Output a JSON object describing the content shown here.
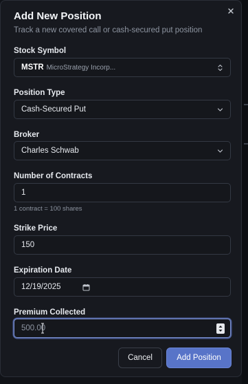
{
  "dialog": {
    "title": "Add New Position",
    "subtitle": "Track a new covered call or cash-secured put position",
    "close_icon": "close-icon"
  },
  "fields": {
    "stock_symbol": {
      "label": "Stock Symbol",
      "ticker": "MSTR",
      "company": "MicroStrategy Incorp...",
      "icon": "chevron-up-down-icon"
    },
    "position_type": {
      "label": "Position Type",
      "value": "Cash-Secured Put",
      "icon": "chevron-down-icon"
    },
    "broker": {
      "label": "Broker",
      "value": "Charles Schwab",
      "icon": "chevron-down-icon"
    },
    "contracts": {
      "label": "Number of Contracts",
      "value": "1",
      "hint": "1 contract = 100 shares"
    },
    "strike": {
      "label": "Strike Price",
      "value": "150"
    },
    "expiration": {
      "label": "Expiration Date",
      "value": "12/19/2025",
      "icon": "calendar-icon"
    },
    "premium": {
      "label": "Premium Collected",
      "value": "500.00",
      "icon": "number-spinner-icon"
    }
  },
  "actions": {
    "cancel_label": "Cancel",
    "add_label": "Add Position"
  },
  "colors": {
    "accent": "#5874c8",
    "focus_ring": "#7a8fcf",
    "background": "#17191f"
  }
}
